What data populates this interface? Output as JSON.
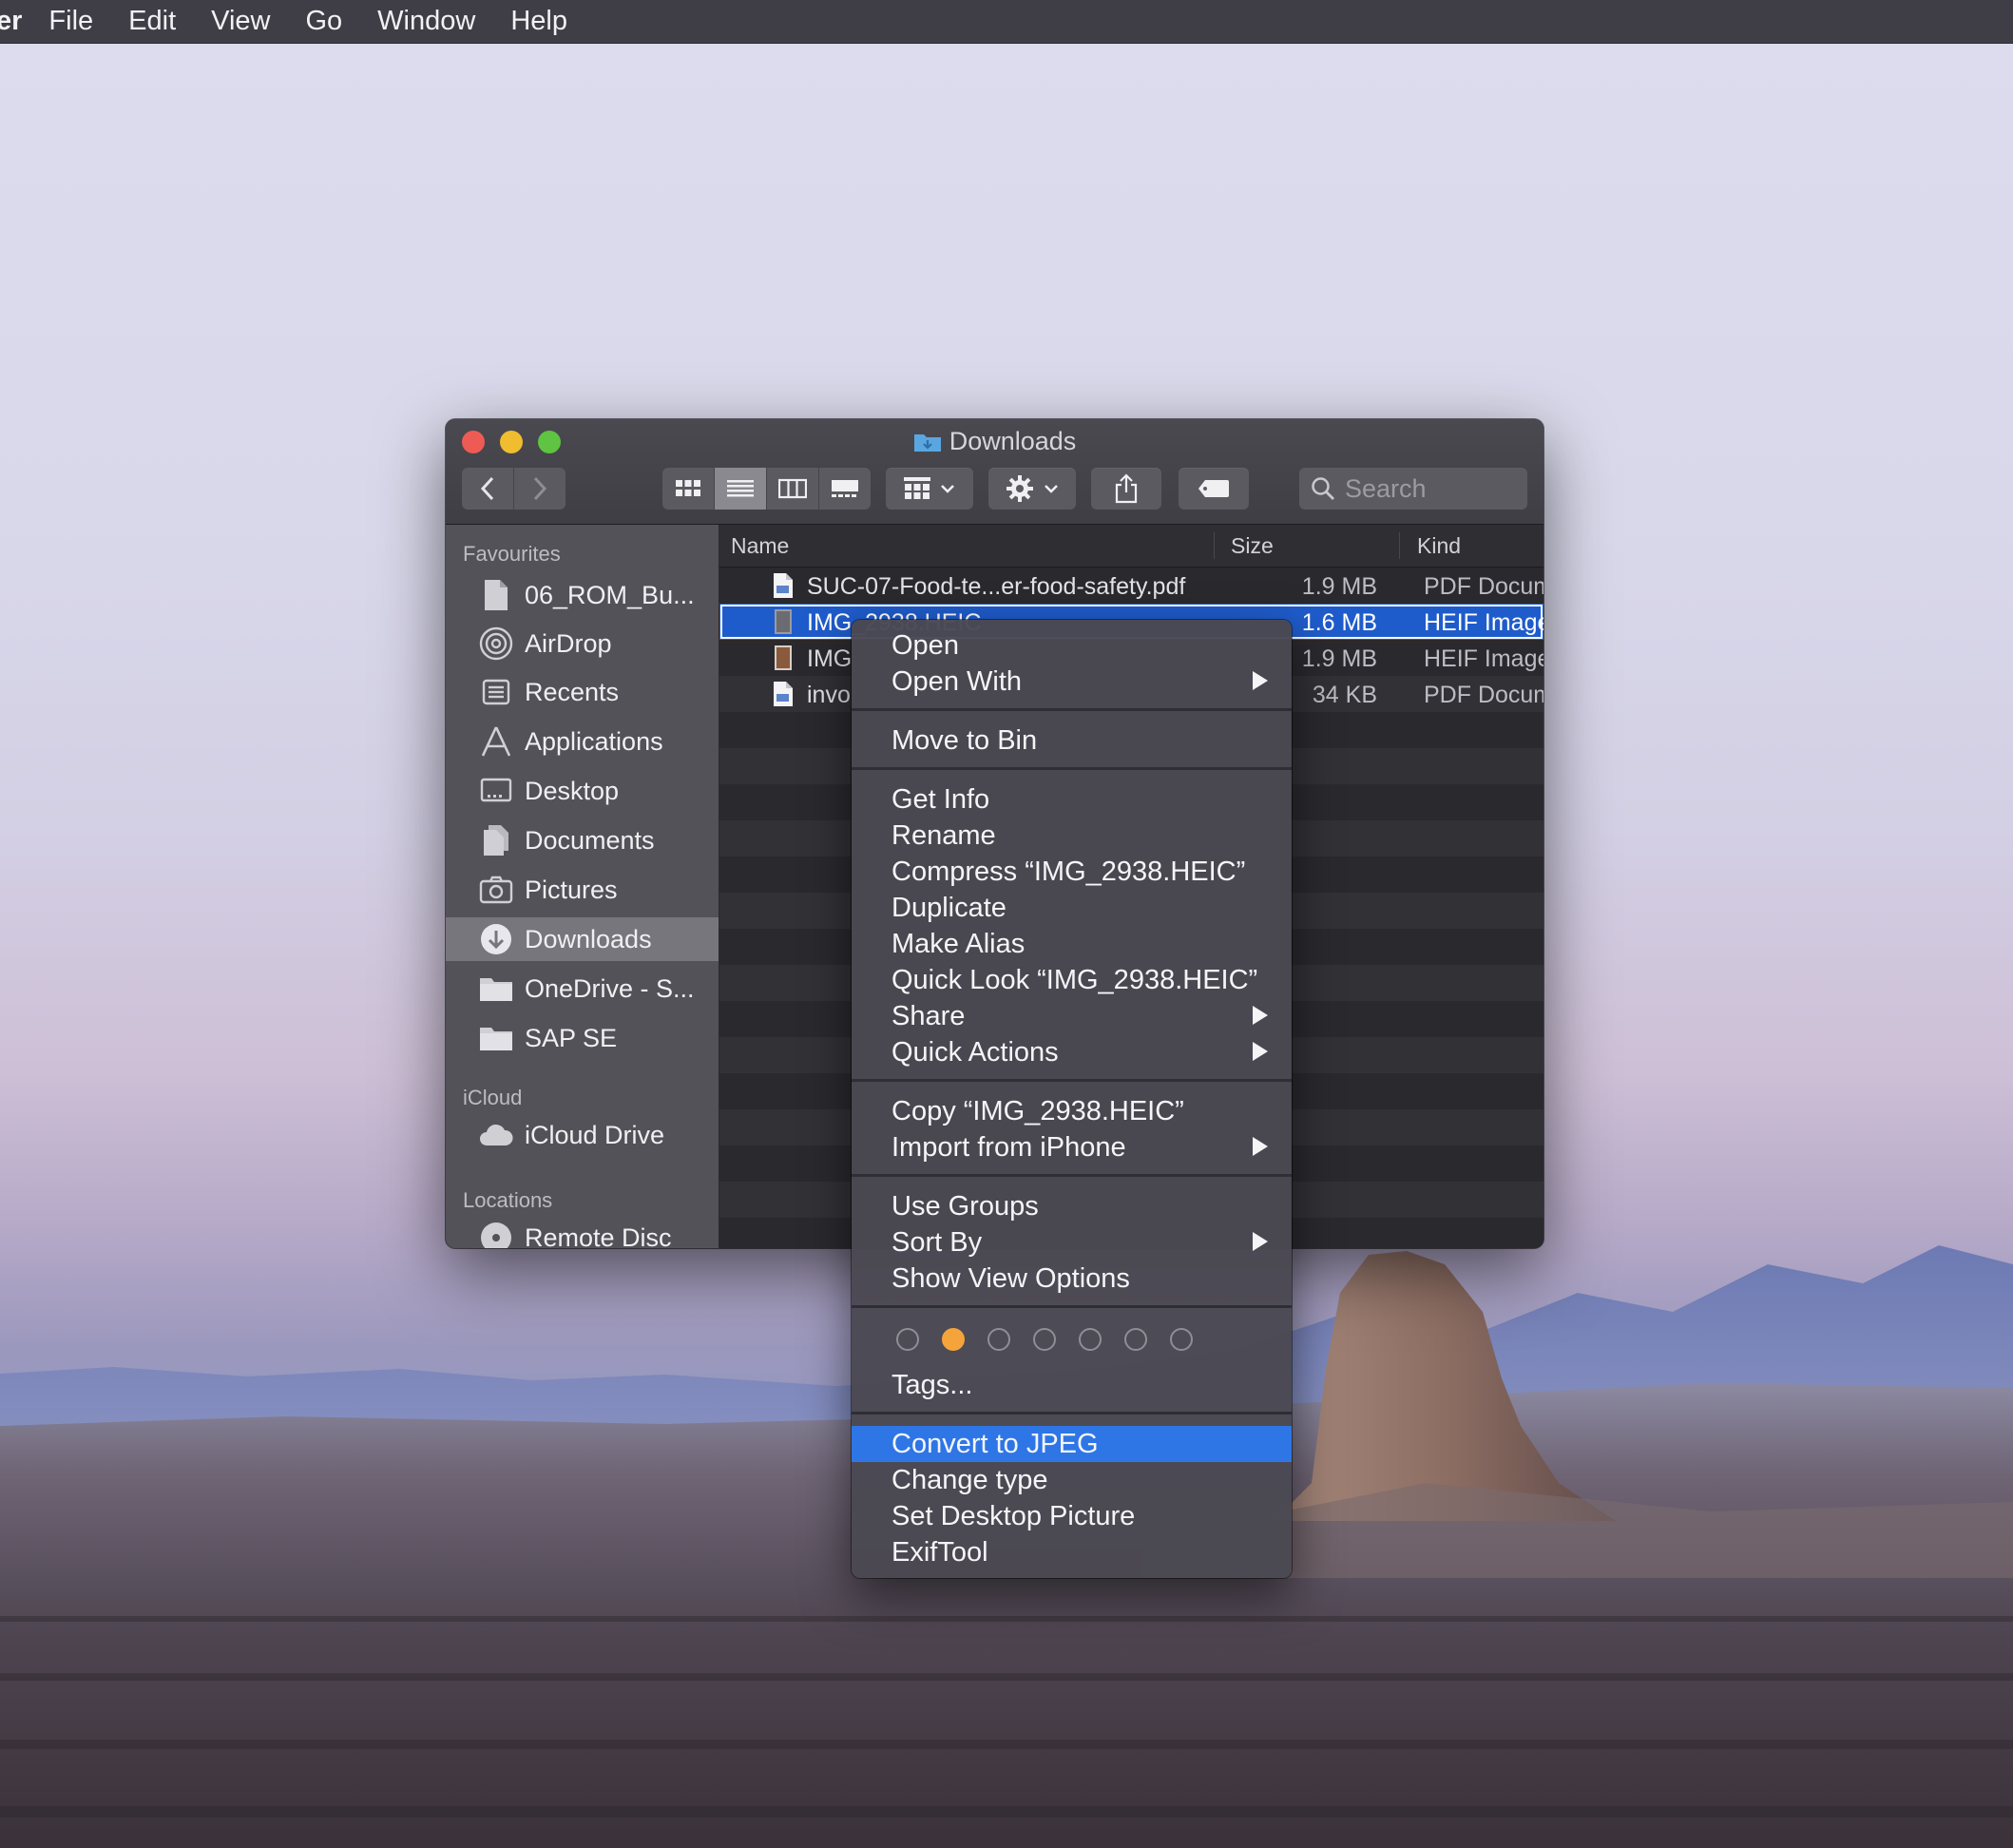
{
  "menubar": {
    "app": "er",
    "items": [
      "File",
      "Edit",
      "View",
      "Go",
      "Window",
      "Help"
    ]
  },
  "window": {
    "title": "Downloads",
    "search_placeholder": "Search"
  },
  "sidebar": {
    "favourites_heading": "Favourites",
    "favourites": [
      {
        "label": "06_ROM_Bu...",
        "icon": "document-icon"
      },
      {
        "label": "AirDrop",
        "icon": "airdrop-icon"
      },
      {
        "label": "Recents",
        "icon": "recents-icon"
      },
      {
        "label": "Applications",
        "icon": "applications-icon"
      },
      {
        "label": "Desktop",
        "icon": "desktop-icon"
      },
      {
        "label": "Documents",
        "icon": "documents-icon"
      },
      {
        "label": "Pictures",
        "icon": "camera-icon"
      },
      {
        "label": "Downloads",
        "icon": "downloads-icon",
        "selected": true
      },
      {
        "label": "OneDrive - S...",
        "icon": "folder-icon"
      },
      {
        "label": "SAP SE",
        "icon": "folder-icon"
      }
    ],
    "icloud_heading": "iCloud",
    "icloud": [
      {
        "label": "iCloud Drive",
        "icon": "cloud-icon"
      }
    ],
    "locations_heading": "Locations",
    "locations": [
      {
        "label": "Remote Disc",
        "icon": "disc-icon"
      }
    ]
  },
  "columns": {
    "name": "Name",
    "size": "Size",
    "kind": "Kind"
  },
  "files": [
    {
      "name": "SUC-07-Food-te...er-food-safety.pdf",
      "size": "1.9 MB",
      "kind": "PDF Docum",
      "icon": "pdf-icon"
    },
    {
      "name": "IMG_2938.HEIC",
      "size": "1.6 MB",
      "kind": "HEIF Image",
      "icon": "image-icon",
      "selected": true
    },
    {
      "name": "IMG",
      "size": "1.9 MB",
      "kind": "HEIF Image",
      "icon": "image-icon"
    },
    {
      "name": "invo",
      "size": "34 KB",
      "kind": "PDF Docum",
      "icon": "pdf-icon"
    }
  ],
  "context_menu": {
    "open": "Open",
    "open_with": "Open With",
    "move_to_bin": "Move to Bin",
    "get_info": "Get Info",
    "rename": "Rename",
    "compress": "Compress “IMG_2938.HEIC”",
    "duplicate": "Duplicate",
    "make_alias": "Make Alias",
    "quick_look": "Quick Look “IMG_2938.HEIC”",
    "share": "Share",
    "quick_actions": "Quick Actions",
    "copy": "Copy “IMG_2938.HEIC”",
    "import_iphone": "Import from iPhone",
    "use_groups": "Use Groups",
    "sort_by": "Sort By",
    "show_view_options": "Show View Options",
    "tags": "Tags...",
    "convert_jpeg": "Convert to JPEG",
    "change_type": "Change type",
    "set_desktop": "Set Desktop Picture",
    "exiftool": "ExifTool",
    "tag_colors": [
      "none",
      "#f4a43a",
      "none",
      "none",
      "none",
      "none",
      "none"
    ]
  },
  "colors": {
    "accent": "#2e76e6",
    "selection": "#1f5ccb",
    "tag_orange": "#f4a43a"
  }
}
